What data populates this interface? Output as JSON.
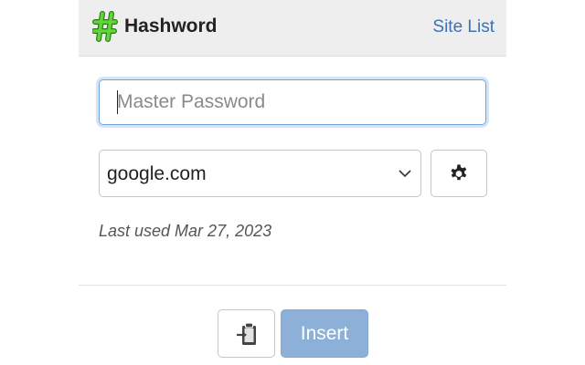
{
  "header": {
    "title": "Hashword",
    "site_list_label": "Site List",
    "logo_icon": "hash-icon",
    "logo_color": "#5fd63b"
  },
  "password": {
    "placeholder": "Master Password",
    "value": ""
  },
  "site_select": {
    "selected": "google.com",
    "icon": "chevron-down-icon"
  },
  "settings_button": {
    "icon": "gear-icon"
  },
  "status": {
    "last_used": "Last used Mar 27, 2023"
  },
  "actions": {
    "copy_icon": "clipboard-icon",
    "insert_label": "Insert",
    "insert_color": "#8cb0d8"
  },
  "colors": {
    "accent": "#3a72b5",
    "focus_border": "#6fa3e0"
  }
}
